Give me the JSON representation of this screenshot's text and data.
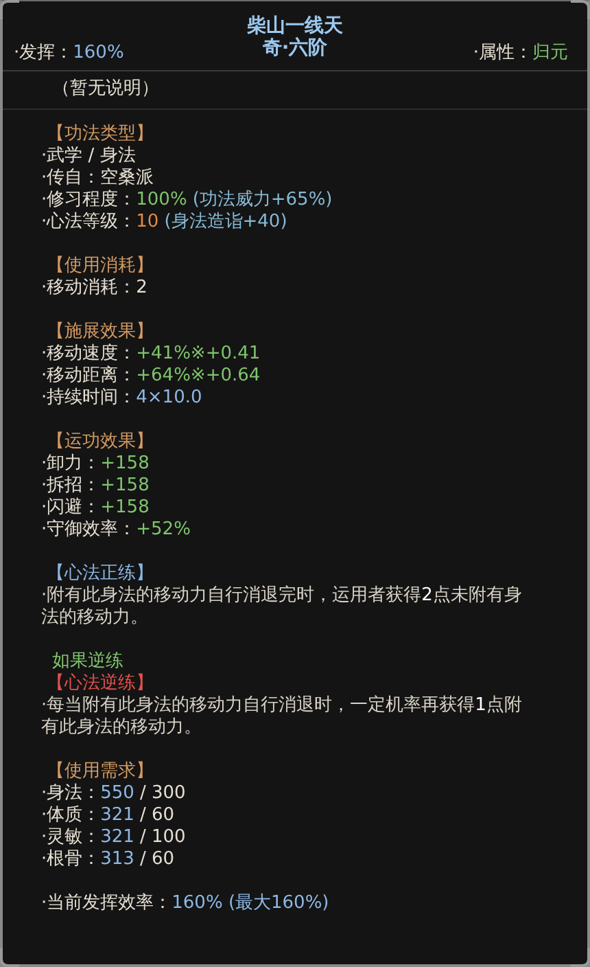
{
  "title": "柴山一线天",
  "grade": "奇·六阶",
  "left_stat": [
    {
      "text": "·发挥：",
      "color": "#e6dfd2"
    },
    {
      "text": "160%",
      "color": "#8db8e6"
    }
  ],
  "right_stat": [
    {
      "text": "·属性：",
      "color": "#e6dfd2"
    },
    {
      "text": "归元",
      "color": "#7fc46c"
    }
  ],
  "description": "（暂无说明）",
  "sections": [
    {
      "heading": "【功法类型】",
      "color": "#d49a62",
      "lines": [
        {
          "kind": "line",
          "segments": [
            {
              "text": "·武学 / 身法",
              "color": "#e6dfd2"
            }
          ]
        },
        {
          "kind": "line",
          "segments": [
            {
              "text": "·传自：空桑派",
              "color": "#e6dfd2"
            }
          ]
        },
        {
          "kind": "line",
          "segments": [
            {
              "text": "·修习程度：",
              "color": "#e6dfd2"
            },
            {
              "text": "100%",
              "color": "#7fc46c"
            },
            {
              "text": "(功法威力+65%)",
              "color": "#86b9d6"
            }
          ]
        },
        {
          "kind": "line",
          "segments": [
            {
              "text": "·心法等级：",
              "color": "#e6dfd2"
            },
            {
              "text": "10",
              "color": "#e38a45"
            },
            {
              "text": "(身法造诣+40)",
              "color": "#86b9d6"
            }
          ]
        }
      ]
    },
    {
      "heading": "【使用消耗】",
      "color": "#d49a62",
      "lines": [
        {
          "kind": "line",
          "segments": [
            {
              "text": "·移动消耗：2",
              "color": "#e6dfd2"
            }
          ]
        }
      ]
    },
    {
      "heading": "【施展效果】",
      "color": "#d49a62",
      "lines": [
        {
          "kind": "line",
          "segments": [
            {
              "text": "·移动速度：",
              "color": "#e6dfd2"
            },
            {
              "text": "+41%※+0.41",
              "color": "#7fc46c"
            }
          ]
        },
        {
          "kind": "line",
          "segments": [
            {
              "text": "·移动距离：",
              "color": "#e6dfd2"
            },
            {
              "text": "+64%※+0.64",
              "color": "#7fc46c"
            }
          ]
        },
        {
          "kind": "line",
          "segments": [
            {
              "text": "·持续时间：",
              "color": "#e6dfd2"
            },
            {
              "text": "4×10.0",
              "color": "#8db8e6"
            }
          ]
        }
      ]
    },
    {
      "heading": "【运功效果】",
      "color": "#d49a62",
      "lines": [
        {
          "kind": "line",
          "segments": [
            {
              "text": "·卸力：",
              "color": "#e6dfd2"
            },
            {
              "text": "+158",
              "color": "#7fc46c"
            }
          ]
        },
        {
          "kind": "line",
          "segments": [
            {
              "text": "·拆招：",
              "color": "#e6dfd2"
            },
            {
              "text": "+158",
              "color": "#7fc46c"
            }
          ]
        },
        {
          "kind": "line",
          "segments": [
            {
              "text": "·闪避：",
              "color": "#e6dfd2"
            },
            {
              "text": "+158",
              "color": "#7fc46c"
            }
          ]
        },
        {
          "kind": "line",
          "segments": [
            {
              "text": "·守御效率：",
              "color": "#e6dfd2"
            },
            {
              "text": "+52%",
              "color": "#7fc46c"
            }
          ]
        }
      ]
    },
    {
      "heading": "【心法正练】",
      "color": "#8ab6e4",
      "lines": [
        {
          "kind": "para",
          "text": "·附有此身法的移动力自行消退完时，运用者获得**2**点未附有身法的移动力。"
        }
      ]
    },
    {
      "condition": "如果逆练",
      "heading": "【心法逆练】",
      "color": "#e4504c",
      "lines": [
        {
          "kind": "para",
          "text": "·每当附有此身法的移动力自行消退时，一定机率再获得**1**点附有此身法的移动力。"
        }
      ]
    },
    {
      "heading": "【使用需求】",
      "color": "#d49a62",
      "lines": [
        {
          "kind": "line",
          "segments": [
            {
              "text": "·身法：",
              "color": "#e6dfd2"
            },
            {
              "text": "550",
              "color": "#8db8e6"
            },
            {
              "text": "/ 300",
              "color": "#e6dfd2"
            }
          ]
        },
        {
          "kind": "line",
          "segments": [
            {
              "text": "·体质：",
              "color": "#e6dfd2"
            },
            {
              "text": "321",
              "color": "#8db8e6"
            },
            {
              "text": "/ 60",
              "color": "#e6dfd2"
            }
          ]
        },
        {
          "kind": "line",
          "segments": [
            {
              "text": "·灵敏：",
              "color": "#e6dfd2"
            },
            {
              "text": "321",
              "color": "#8db8e6"
            },
            {
              "text": "/ 100",
              "color": "#e6dfd2"
            }
          ]
        },
        {
          "kind": "line",
          "segments": [
            {
              "text": "·根骨：",
              "color": "#e6dfd2"
            },
            {
              "text": "313",
              "color": "#8db8e6"
            },
            {
              "text": "/ 60",
              "color": "#e6dfd2"
            }
          ]
        }
      ]
    }
  ],
  "footer": [
    {
      "text": "·当前发挥效率：",
      "color": "#e6dfd2"
    },
    {
      "text": "160% (最大160%)",
      "color": "#8db8e6"
    }
  ]
}
